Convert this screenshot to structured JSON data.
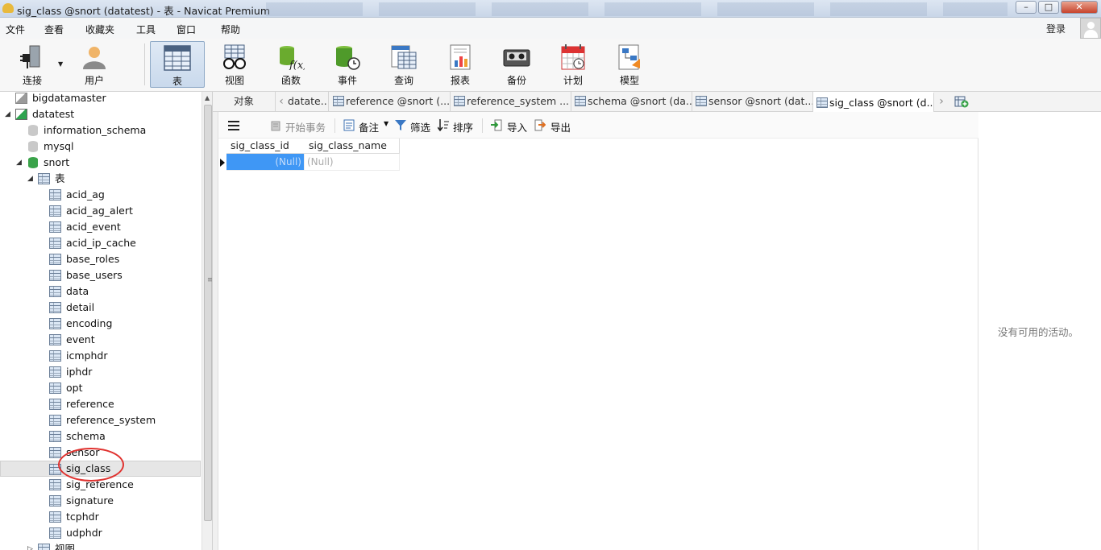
{
  "window": {
    "title": "sig_class @snort (datatest) - 表 - Navicat Premium",
    "buttons": {
      "minimize": "–",
      "maximize": "□",
      "close": "✕"
    }
  },
  "menu": {
    "items": [
      "文件",
      "查看",
      "收藏夹",
      "工具",
      "窗口",
      "帮助"
    ],
    "login": "登录"
  },
  "toolbar": {
    "items": [
      {
        "label": "连接",
        "icon": "plug-icon"
      },
      {
        "label": "用户",
        "icon": "user-icon"
      },
      {
        "label": "表",
        "icon": "table-icon",
        "active": true
      },
      {
        "label": "视图",
        "icon": "view-glasses-icon"
      },
      {
        "label": "函数",
        "icon": "function-icon"
      },
      {
        "label": "事件",
        "icon": "event-clock-icon"
      },
      {
        "label": "查询",
        "icon": "query-icon"
      },
      {
        "label": "报表",
        "icon": "report-icon"
      },
      {
        "label": "备份",
        "icon": "backup-icon"
      },
      {
        "label": "计划",
        "icon": "schedule-icon"
      },
      {
        "label": "模型",
        "icon": "model-icon"
      }
    ]
  },
  "sidebar": {
    "tree": [
      {
        "label": "bigdatamaster",
        "icon": "connection-off-icon",
        "level": 0
      },
      {
        "label": "datatest",
        "icon": "connection-icon",
        "level": 0,
        "expanded": true
      },
      {
        "label": "information_schema",
        "icon": "database-icon",
        "level": 1
      },
      {
        "label": "mysql",
        "icon": "database-icon",
        "level": 1
      },
      {
        "label": "snort",
        "icon": "database-open-icon",
        "level": 1,
        "expanded": true
      },
      {
        "label": "表",
        "icon": "tables-folder-icon",
        "level": 2,
        "expanded": true
      },
      {
        "label": "acid_ag",
        "icon": "table-icon",
        "level": 3
      },
      {
        "label": "acid_ag_alert",
        "icon": "table-icon",
        "level": 3
      },
      {
        "label": "acid_event",
        "icon": "table-icon",
        "level": 3
      },
      {
        "label": "acid_ip_cache",
        "icon": "table-icon",
        "level": 3
      },
      {
        "label": "base_roles",
        "icon": "table-icon",
        "level": 3
      },
      {
        "label": "base_users",
        "icon": "table-icon",
        "level": 3
      },
      {
        "label": "data",
        "icon": "table-icon",
        "level": 3
      },
      {
        "label": "detail",
        "icon": "table-icon",
        "level": 3
      },
      {
        "label": "encoding",
        "icon": "table-icon",
        "level": 3
      },
      {
        "label": "event",
        "icon": "table-icon",
        "level": 3
      },
      {
        "label": "icmphdr",
        "icon": "table-icon",
        "level": 3
      },
      {
        "label": "iphdr",
        "icon": "table-icon",
        "level": 3
      },
      {
        "label": "opt",
        "icon": "table-icon",
        "level": 3
      },
      {
        "label": "reference",
        "icon": "table-icon",
        "level": 3
      },
      {
        "label": "reference_system",
        "icon": "table-icon",
        "level": 3
      },
      {
        "label": "schema",
        "icon": "table-icon",
        "level": 3
      },
      {
        "label": "sensor",
        "icon": "table-icon",
        "level": 3
      },
      {
        "label": "sig_class",
        "icon": "table-icon",
        "level": 3,
        "selected": true
      },
      {
        "label": "sig_reference",
        "icon": "table-icon",
        "level": 3
      },
      {
        "label": "signature",
        "icon": "table-icon",
        "level": 3
      },
      {
        "label": "tcphdr",
        "icon": "table-icon",
        "level": 3
      },
      {
        "label": "udphdr",
        "icon": "table-icon",
        "level": 3
      },
      {
        "label": "视图",
        "icon": "views-folder-icon",
        "level": 2
      }
    ]
  },
  "tabs": {
    "object_tab": "对象",
    "items": [
      {
        "label": "datate..."
      },
      {
        "label": "reference @snort (..."
      },
      {
        "label": "reference_system ..."
      },
      {
        "label": "schema @snort (da..."
      },
      {
        "label": "sensor @snort (dat..."
      },
      {
        "label": "sig_class @snort (d...",
        "active": true
      }
    ]
  },
  "subtoolbar": {
    "menu_icon": "hamburger-menu-icon",
    "begin_transaction": "开始事务",
    "memo": "备注",
    "filter": "筛选",
    "sort": "排序",
    "import": "导入",
    "export": "导出"
  },
  "grid": {
    "columns": [
      "sig_class_id",
      "sig_class_name"
    ],
    "rows": [
      [
        "(Null)",
        "(Null)"
      ]
    ]
  },
  "right_panel": {
    "message": "没有可用的活动。"
  },
  "colors": {
    "selection": "#3f97f5",
    "annotation_circle": "#e0322f"
  }
}
